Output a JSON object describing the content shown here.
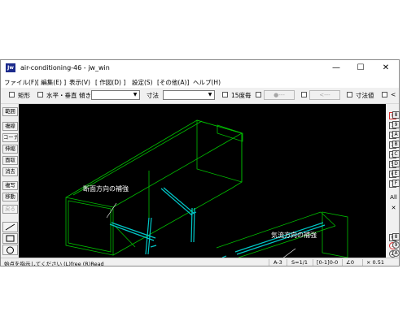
{
  "window": {
    "title": "air-conditioning-46 - jw_win",
    "icon_label": "Jw",
    "controls": {
      "minimize": "—",
      "maximize": "☐",
      "close": "✕"
    }
  },
  "menu": [
    {
      "label": "ファイル(F)"
    },
    {
      "label": "[ 編集(E) ]"
    },
    {
      "label": "表示(V)"
    },
    {
      "label": "[ 作図(D) ]"
    },
    {
      "label": "設定(S)"
    },
    {
      "label": "[その他(A)]"
    },
    {
      "label": "ヘルプ(H)"
    }
  ],
  "toolbar": {
    "rect_label": "矩形",
    "hv_label": "水平・垂直",
    "slope_label": "傾き",
    "slope_value": "",
    "dimension_label": "寸法",
    "dimension_value": "",
    "deg15_label": "15度毎",
    "btn_dash1": "●---",
    "btn_dash2": "<---",
    "dimval_label": "寸法値",
    "lt_label": "<"
  },
  "left_tools": [
    "範囲",
    "複線",
    "コーナー",
    "伸縮",
    "面取",
    "消去",
    "複写",
    "移動",
    "戻る"
  ],
  "right_panel": {
    "layer_groups": [
      "0",
      "8",
      "1",
      "9",
      "2",
      "A",
      "3",
      "B",
      "4",
      "C",
      "5",
      "D",
      "6",
      "E",
      "7",
      "F"
    ],
    "all_label": "All",
    "cross_label": "✕",
    "layers_bottom": [
      "0",
      "8",
      "1",
      "9",
      "2",
      "A"
    ]
  },
  "drawing": {
    "annotation_1": "断面方向の補強",
    "annotation_2": "気流方向の補強",
    "colors": {
      "duct_line": "#00c000",
      "reinforcement": "#00c8c8",
      "text": "#ffffff",
      "background": "#000000"
    }
  },
  "status": {
    "hint": "始点を指示してください (L)free (R)Read",
    "paper": "A-3",
    "scale": "S=1/1",
    "layer": "[0-1]0-0",
    "angle": "∠0",
    "zoom": "× 0.51"
  }
}
